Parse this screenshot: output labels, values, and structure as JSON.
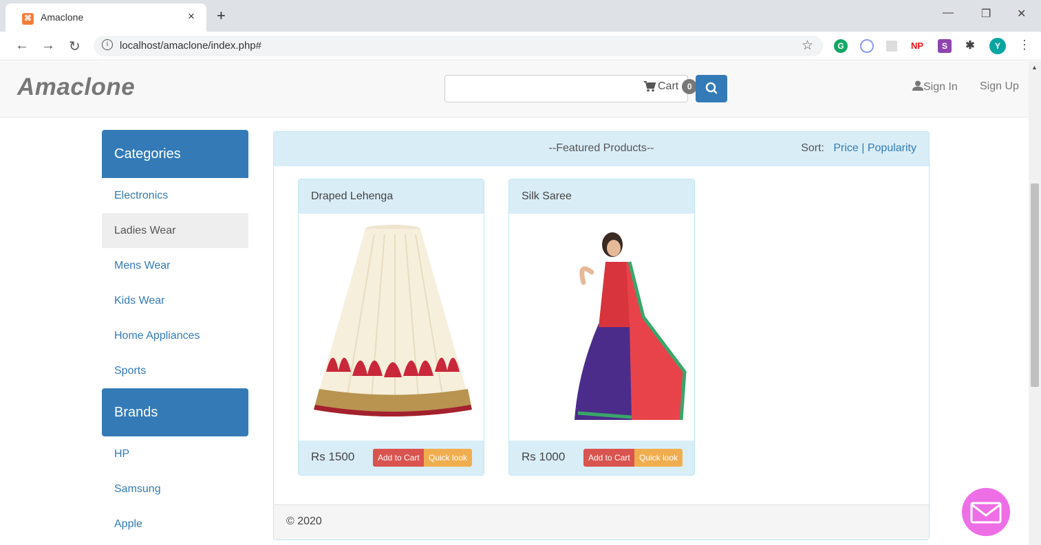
{
  "browser": {
    "tab_title": "Amaclone",
    "tab_close": "×",
    "new_tab": "+",
    "url": "localhost/amaclone/index.php#",
    "extensions": [
      "G",
      "O",
      "NP",
      "S",
      "Y"
    ]
  },
  "navbar": {
    "brand": "Amaclone",
    "search": {
      "value": "",
      "placeholder": ""
    },
    "cart_label": "Cart",
    "cart_count": "0",
    "sign_in": "Sign In",
    "sign_up": "Sign Up"
  },
  "sidebar": {
    "categories_title": "Categories",
    "categories": [
      {
        "label": "Electronics",
        "active": false
      },
      {
        "label": "Ladies Wear",
        "active": true
      },
      {
        "label": "Mens Wear",
        "active": false
      },
      {
        "label": "Kids Wear",
        "active": false
      },
      {
        "label": "Home Appliances",
        "active": false
      },
      {
        "label": "Sports",
        "active": false
      }
    ],
    "brands_title": "Brands",
    "brands": [
      "HP",
      "Samsung",
      "Apple"
    ]
  },
  "products_panel": {
    "title": "--Featured Products--",
    "sort_label": "Sort:",
    "sort_price": "Price",
    "sort_separator": "|",
    "sort_popularity": "Popularity",
    "products": [
      {
        "name": "Draped Lehenga",
        "price": "Rs 1500",
        "add_label": "Add to Cart",
        "look_label": "Quick look"
      },
      {
        "name": "Silk Saree",
        "price": "Rs 1000",
        "add_label": "Add to Cart",
        "look_label": "Quick look"
      }
    ]
  },
  "footer": {
    "text": "© 2020"
  },
  "colors": {
    "primary": "#337ab7",
    "panel_info": "#d9edf7",
    "danger": "#d9534f",
    "warning": "#f0ad4e",
    "chat": "#ee6ee6"
  }
}
